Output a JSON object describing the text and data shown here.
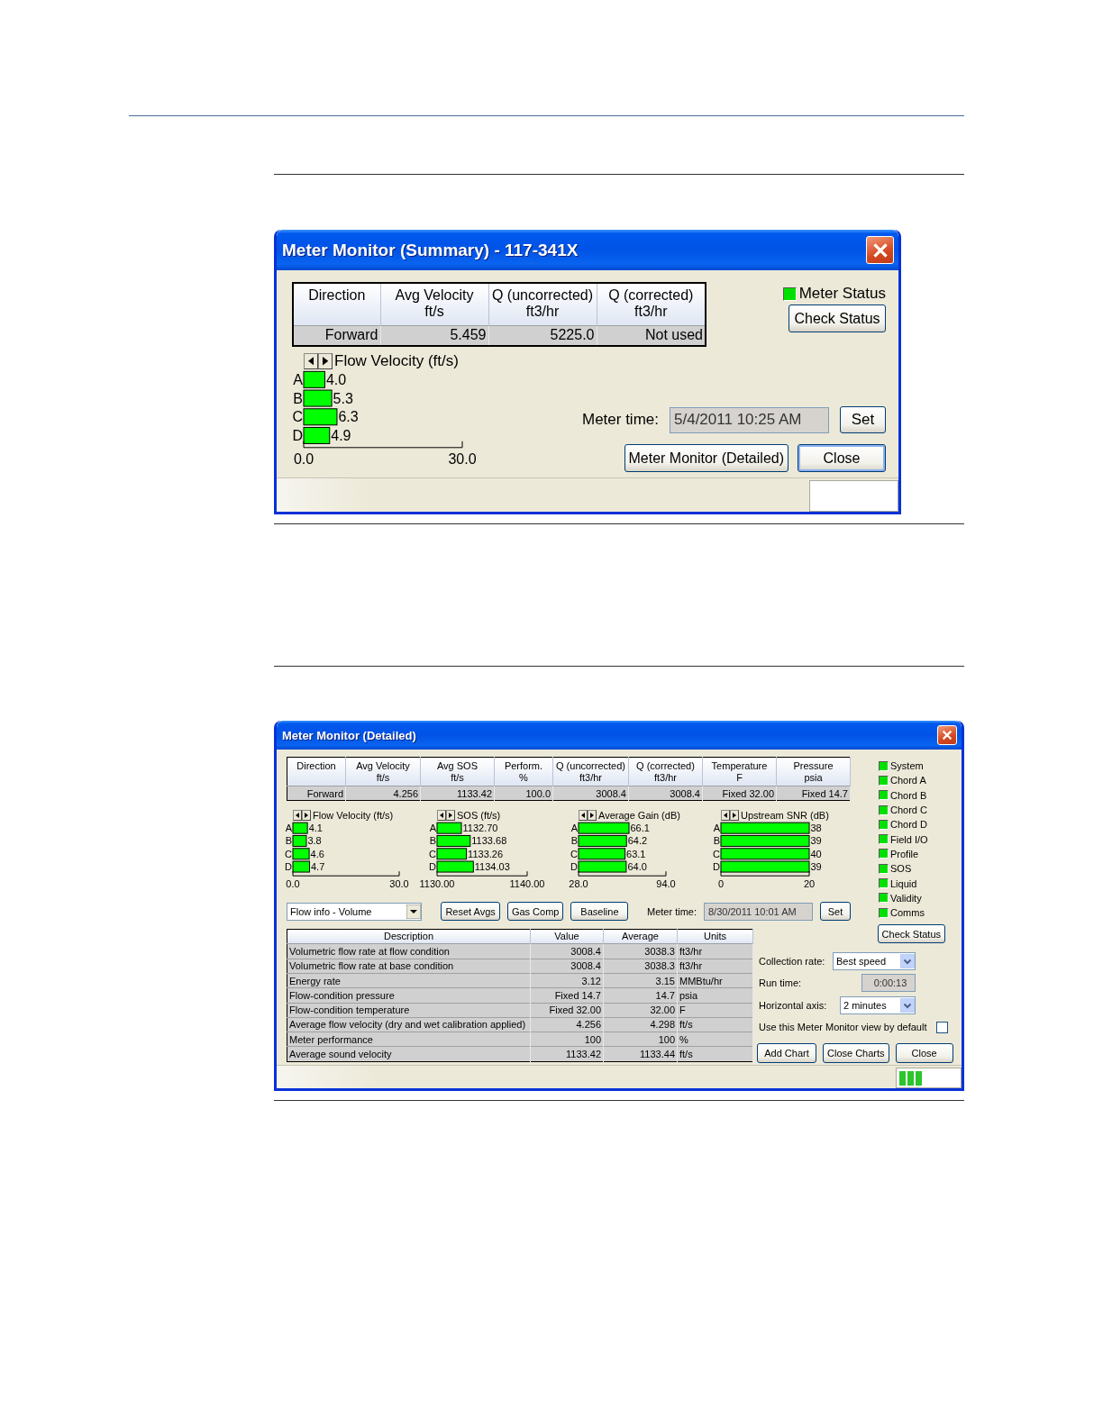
{
  "summary_window": {
    "title": "Meter Monitor (Summary) - 117-341X",
    "table": {
      "columns": [
        {
          "header": "Direction"
        },
        {
          "header": "Avg Velocity",
          "unit": "ft/s"
        },
        {
          "header": "Q (uncorrected)",
          "unit": "ft3/hr"
        },
        {
          "header": "Q (corrected)",
          "unit": "ft3/hr"
        }
      ],
      "rows": [
        [
          "Forward",
          "5.459",
          "5225.0",
          "Not used"
        ]
      ]
    },
    "meter_status": {
      "label": "Meter Status",
      "on": true
    },
    "check_status_button": "Check Status",
    "chart": {
      "chart_data": {
        "type": "bar",
        "orientation": "horizontal",
        "title": "Flow Velocity (ft/s)",
        "categories": [
          "A",
          "B",
          "C",
          "D"
        ],
        "values": [
          4.0,
          5.3,
          6.3,
          4.9
        ],
        "value_labels": [
          "4.0",
          "5.3",
          "6.3",
          "4.9"
        ],
        "xlim": [
          0,
          30
        ],
        "xticks": [
          {
            "value": 0,
            "label": "0.0"
          },
          {
            "value": 30,
            "label": "30.0"
          }
        ]
      }
    },
    "meter_time": {
      "label": "Meter time:",
      "value": "5/4/2011 10:25 AM"
    },
    "set_button": "Set",
    "buttons": [
      {
        "label": "Meter Monitor (Detailed)",
        "default": false
      },
      {
        "label": "Close",
        "default": true
      }
    ]
  },
  "detailed_window": {
    "title": "Meter Monitor (Detailed)",
    "table": {
      "columns": [
        {
          "header": "Direction"
        },
        {
          "header": "Avg Velocity",
          "unit": "ft/s"
        },
        {
          "header": "Avg SOS",
          "unit": "ft/s"
        },
        {
          "header": "Perform.",
          "unit": "%"
        },
        {
          "header": "Q (uncorrected)",
          "unit": "ft3/hr"
        },
        {
          "header": "Q (corrected)",
          "unit": "ft3/hr"
        },
        {
          "header": "Temperature",
          "unit": "F"
        },
        {
          "header": "Pressure",
          "unit": "psia"
        }
      ],
      "rows": [
        [
          "Forward",
          "4.256",
          "1133.42",
          "100.0",
          "3008.4",
          "3008.4",
          "Fixed 32.00",
          "Fixed 14.7"
        ]
      ]
    },
    "charts": [
      {
        "chart_data": {
          "type": "bar",
          "orientation": "horizontal",
          "title": "Flow Velocity (ft/s)",
          "categories": [
            "A",
            "B",
            "C",
            "D"
          ],
          "values": [
            4.1,
            3.8,
            4.6,
            4.7
          ],
          "value_labels": [
            "4.1",
            "3.8",
            "4.6",
            "4.7"
          ],
          "xlim": [
            0,
            30
          ],
          "xticks": [
            {
              "value": 0,
              "label": "0.0"
            },
            {
              "value": 30,
              "label": "30.0"
            }
          ]
        }
      },
      {
        "chart_data": {
          "type": "bar",
          "orientation": "horizontal",
          "title": "SOS (ft/s)",
          "categories": [
            "A",
            "B",
            "C",
            "D"
          ],
          "values": [
            1132.7,
            1133.68,
            1133.26,
            1134.03
          ],
          "value_labels": [
            "1132.70",
            "1133.68",
            "1133.26",
            "1134.03"
          ],
          "xlim": [
            1130,
            1140
          ],
          "xticks": [
            {
              "value": 1130,
              "label": "1130.00"
            },
            {
              "value": 1140,
              "label": "1140.00"
            }
          ]
        }
      },
      {
        "chart_data": {
          "type": "bar",
          "orientation": "horizontal",
          "title": "Average Gain (dB)",
          "categories": [
            "A",
            "B",
            "C",
            "D"
          ],
          "values": [
            66.1,
            64.2,
            63.1,
            64.0
          ],
          "value_labels": [
            "66.1",
            "64.2",
            "63.1",
            "64.0"
          ],
          "xlim": [
            28,
            94
          ],
          "xticks": [
            {
              "value": 28,
              "label": "28.0"
            },
            {
              "value": 94,
              "label": "94.0"
            }
          ]
        }
      },
      {
        "kind": "off_scale_meter",
        "title": "Upstream SNR (dB)",
        "categories": [
          "A",
          "B",
          "C",
          "D"
        ],
        "value_labels": [
          "38",
          "39",
          "40",
          "39"
        ],
        "scale_labels": [
          "0",
          "20"
        ]
      }
    ],
    "indicators": [
      {
        "label": "System",
        "on": true
      },
      {
        "label": "Chord A",
        "on": true
      },
      {
        "label": "Chord B",
        "on": true
      },
      {
        "label": "Chord C",
        "on": true
      },
      {
        "label": "Chord D",
        "on": true
      },
      {
        "label": "Field I/O",
        "on": true
      },
      {
        "label": "Profile",
        "on": true
      },
      {
        "label": "SOS",
        "on": true
      },
      {
        "label": "Liquid",
        "on": true
      },
      {
        "label": "Validity",
        "on": true
      },
      {
        "label": "Comms",
        "on": true
      }
    ],
    "check_status_button": "Check Status",
    "view_select": "Flow info - Volume",
    "action_buttons": [
      "Reset Avgs",
      "Gas Comp",
      "Baseline"
    ],
    "meter_time": {
      "label": "Meter time:",
      "value": "8/30/2011 10:01 AM"
    },
    "set_button": "Set",
    "details_table": {
      "columns": [
        "Description",
        "Value",
        "Average",
        "Units"
      ],
      "rows": [
        [
          "Volumetric flow rate at flow condition",
          "3008.4",
          "3038.3",
          "ft3/hr"
        ],
        [
          "Volumetric flow rate at base condition",
          "3008.4",
          "3038.3",
          "ft3/hr"
        ],
        [
          "Energy rate",
          "3.12",
          "3.15",
          "MMBtu/hr"
        ],
        [
          "Flow-condition pressure",
          "Fixed 14.7",
          "14.7",
          "psia"
        ],
        [
          "Flow-condition temperature",
          "Fixed 32.00",
          "32.00",
          "F"
        ],
        [
          "Average flow velocity (dry and wet calibration applied)",
          "4.256",
          "4.298",
          "ft/s"
        ],
        [
          "Meter performance",
          "100",
          "100",
          "%"
        ],
        [
          "Average sound velocity",
          "1133.42",
          "1133.44",
          "ft/s"
        ]
      ]
    },
    "collection_rate": {
      "label": "Collection rate:",
      "value": "Best speed"
    },
    "run_time": {
      "label": "Run time:",
      "value": "0:00:13"
    },
    "horizontal_axis": {
      "label": "Horizontal axis:",
      "value": "2 minutes"
    },
    "default_view": {
      "label": "Use this Meter Monitor view by default",
      "checked": false
    },
    "buttons": [
      "Add Chart",
      "Close Charts",
      "Close"
    ]
  }
}
